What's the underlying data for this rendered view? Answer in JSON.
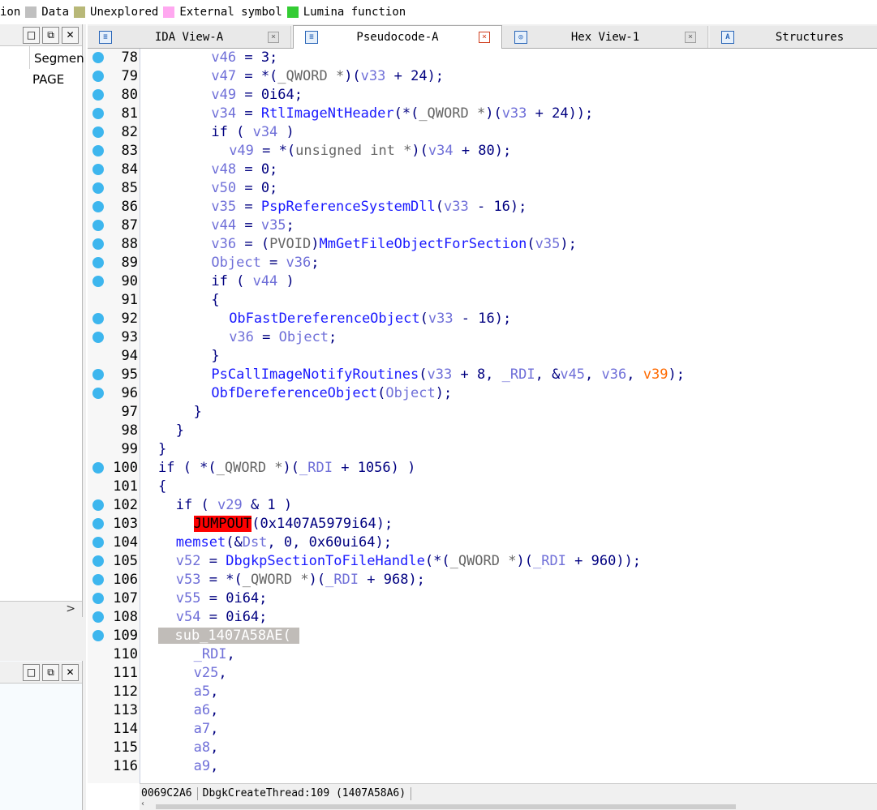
{
  "legend": {
    "items": [
      {
        "label": "ion",
        "color": ""
      },
      {
        "label": "Data",
        "color": "#c0c0c0"
      },
      {
        "label": "Unexplored",
        "color": "#b8b878"
      },
      {
        "label": "External symbol",
        "color": "#ffa8f0"
      },
      {
        "label": "Lumina function",
        "color": "#33cc33"
      }
    ]
  },
  "left_pane": {
    "column_header": "Segmen",
    "rows": [
      "PAGE"
    ],
    "buttons": [
      "□",
      "⧉",
      "✕"
    ]
  },
  "tabs": [
    {
      "label": "IDA View-A",
      "icon": "disassembly-icon",
      "active": false
    },
    {
      "label": "Pseudocode-A",
      "icon": "pseudocode-icon",
      "active": true
    },
    {
      "label": "Hex View-1",
      "icon": "hex-icon",
      "active": false
    },
    {
      "label": "Structures",
      "icon": "structures-icon",
      "active": false
    }
  ],
  "code_lines": [
    {
      "n": "78",
      "dot": true,
      "indent": 6,
      "tokens": [
        [
          "var",
          "v46"
        ],
        [
          "op",
          " = 3;"
        ]
      ]
    },
    {
      "n": "79",
      "dot": true,
      "indent": 6,
      "tokens": [
        [
          "var",
          "v47"
        ],
        [
          "op",
          " = *("
        ],
        [
          "typ",
          "_QWORD *"
        ],
        [
          "op",
          ")("
        ],
        [
          "var",
          "v33"
        ],
        [
          "op",
          " + 24);"
        ]
      ]
    },
    {
      "n": "80",
      "dot": true,
      "indent": 6,
      "tokens": [
        [
          "var",
          "v49"
        ],
        [
          "op",
          " = 0i64;"
        ]
      ]
    },
    {
      "n": "81",
      "dot": true,
      "indent": 6,
      "tokens": [
        [
          "var",
          "v34"
        ],
        [
          "op",
          " = "
        ],
        [
          "fn",
          "RtlImageNtHeader"
        ],
        [
          "op",
          "(*("
        ],
        [
          "typ",
          "_QWORD *"
        ],
        [
          "op",
          ")("
        ],
        [
          "var",
          "v33"
        ],
        [
          "op",
          " + 24));"
        ]
      ]
    },
    {
      "n": "82",
      "dot": true,
      "indent": 6,
      "tokens": [
        [
          "op",
          "if ( "
        ],
        [
          "var",
          "v34"
        ],
        [
          "op",
          " )"
        ]
      ]
    },
    {
      "n": "83",
      "dot": true,
      "indent": 8,
      "tokens": [
        [
          "var",
          "v49"
        ],
        [
          "op",
          " = *("
        ],
        [
          "typ",
          "unsigned int *"
        ],
        [
          "op",
          ")("
        ],
        [
          "var",
          "v34"
        ],
        [
          "op",
          " + 80);"
        ]
      ]
    },
    {
      "n": "84",
      "dot": true,
      "indent": 6,
      "tokens": [
        [
          "var",
          "v48"
        ],
        [
          "op",
          " = 0;"
        ]
      ]
    },
    {
      "n": "85",
      "dot": true,
      "indent": 6,
      "tokens": [
        [
          "var",
          "v50"
        ],
        [
          "op",
          " = 0;"
        ]
      ]
    },
    {
      "n": "86",
      "dot": true,
      "indent": 6,
      "tokens": [
        [
          "var",
          "v35"
        ],
        [
          "op",
          " = "
        ],
        [
          "fn",
          "PspReferenceSystemDll"
        ],
        [
          "op",
          "("
        ],
        [
          "var",
          "v33"
        ],
        [
          "op",
          " - 16);"
        ]
      ]
    },
    {
      "n": "87",
      "dot": true,
      "indent": 6,
      "tokens": [
        [
          "var",
          "v44"
        ],
        [
          "op",
          " = "
        ],
        [
          "var",
          "v35"
        ],
        [
          "op",
          ";"
        ]
      ]
    },
    {
      "n": "88",
      "dot": true,
      "indent": 6,
      "tokens": [
        [
          "var",
          "v36"
        ],
        [
          "op",
          " = ("
        ],
        [
          "typ",
          "PVOID"
        ],
        [
          "op",
          ")"
        ],
        [
          "fn",
          "MmGetFileObjectForSection"
        ],
        [
          "op",
          "("
        ],
        [
          "var",
          "v35"
        ],
        [
          "op",
          ");"
        ]
      ]
    },
    {
      "n": "89",
      "dot": true,
      "indent": 6,
      "tokens": [
        [
          "var",
          "Object"
        ],
        [
          "op",
          " = "
        ],
        [
          "var",
          "v36"
        ],
        [
          "op",
          ";"
        ]
      ]
    },
    {
      "n": "90",
      "dot": true,
      "indent": 6,
      "tokens": [
        [
          "op",
          "if ( "
        ],
        [
          "var",
          "v44"
        ],
        [
          "op",
          " )"
        ]
      ]
    },
    {
      "n": "91",
      "dot": false,
      "indent": 6,
      "tokens": [
        [
          "op",
          "{"
        ]
      ]
    },
    {
      "n": "92",
      "dot": true,
      "indent": 8,
      "tokens": [
        [
          "fn",
          "ObFastDereferenceObject"
        ],
        [
          "op",
          "("
        ],
        [
          "var",
          "v33"
        ],
        [
          "op",
          " - 16);"
        ]
      ]
    },
    {
      "n": "93",
      "dot": true,
      "indent": 8,
      "tokens": [
        [
          "var",
          "v36"
        ],
        [
          "op",
          " = "
        ],
        [
          "var",
          "Object"
        ],
        [
          "op",
          ";"
        ]
      ]
    },
    {
      "n": "94",
      "dot": false,
      "indent": 6,
      "tokens": [
        [
          "op",
          "}"
        ]
      ]
    },
    {
      "n": "95",
      "dot": true,
      "indent": 6,
      "tokens": [
        [
          "fn",
          "PsCallImageNotifyRoutines"
        ],
        [
          "op",
          "("
        ],
        [
          "var",
          "v33"
        ],
        [
          "op",
          " + 8, "
        ],
        [
          "var",
          "_RDI"
        ],
        [
          "op",
          ", &"
        ],
        [
          "var",
          "v45"
        ],
        [
          "op",
          ", "
        ],
        [
          "var",
          "v36"
        ],
        [
          "op",
          ", "
        ],
        [
          "org",
          "v39"
        ],
        [
          "op",
          ");"
        ]
      ]
    },
    {
      "n": "96",
      "dot": true,
      "indent": 6,
      "tokens": [
        [
          "fn",
          "ObfDereferenceObject"
        ],
        [
          "op",
          "("
        ],
        [
          "var",
          "Object"
        ],
        [
          "op",
          ");"
        ]
      ]
    },
    {
      "n": "97",
      "dot": false,
      "indent": 4,
      "tokens": [
        [
          "op",
          "}"
        ]
      ]
    },
    {
      "n": "98",
      "dot": false,
      "indent": 2,
      "tokens": [
        [
          "op",
          "}"
        ]
      ]
    },
    {
      "n": "99",
      "dot": false,
      "indent": 0,
      "tokens": [
        [
          "op",
          "}"
        ]
      ]
    },
    {
      "n": "100",
      "dot": true,
      "indent": 0,
      "tokens": [
        [
          "op",
          "if ( *("
        ],
        [
          "typ",
          "_QWORD *"
        ],
        [
          "op",
          ")("
        ],
        [
          "var",
          "_RDI"
        ],
        [
          "op",
          " + 1056) )"
        ]
      ]
    },
    {
      "n": "101",
      "dot": false,
      "indent": 0,
      "tokens": [
        [
          "op",
          "{"
        ]
      ]
    },
    {
      "n": "102",
      "dot": true,
      "indent": 2,
      "tokens": [
        [
          "op",
          "if ( "
        ],
        [
          "var",
          "v29"
        ],
        [
          "op",
          " & 1 )"
        ]
      ]
    },
    {
      "n": "103",
      "dot": true,
      "indent": 4,
      "tokens": [
        [
          "jump",
          "JUMPOUT"
        ],
        [
          "op",
          "(0x1407A5979i64);"
        ]
      ]
    },
    {
      "n": "104",
      "dot": true,
      "indent": 2,
      "tokens": [
        [
          "fn",
          "memset"
        ],
        [
          "op",
          "(&"
        ],
        [
          "var",
          "Dst"
        ],
        [
          "op",
          ", 0, 0x60ui64);"
        ]
      ]
    },
    {
      "n": "105",
      "dot": true,
      "indent": 2,
      "tokens": [
        [
          "var",
          "v52"
        ],
        [
          "op",
          " = "
        ],
        [
          "fn",
          "DbgkpSectionToFileHandle"
        ],
        [
          "op",
          "(*("
        ],
        [
          "typ",
          "_QWORD *"
        ],
        [
          "op",
          ")("
        ],
        [
          "var",
          "_RDI"
        ],
        [
          "op",
          " + 960));"
        ]
      ]
    },
    {
      "n": "106",
      "dot": true,
      "indent": 2,
      "tokens": [
        [
          "var",
          "v53"
        ],
        [
          "op",
          " = *("
        ],
        [
          "typ",
          "_QWORD *"
        ],
        [
          "op",
          ")("
        ],
        [
          "var",
          "_RDI"
        ],
        [
          "op",
          " + 968);"
        ]
      ]
    },
    {
      "n": "107",
      "dot": true,
      "indent": 2,
      "tokens": [
        [
          "var",
          "v55"
        ],
        [
          "op",
          " = 0i64;"
        ]
      ]
    },
    {
      "n": "108",
      "dot": true,
      "indent": 2,
      "tokens": [
        [
          "var",
          "v54"
        ],
        [
          "op",
          " = 0i64;"
        ]
      ]
    },
    {
      "n": "109",
      "dot": true,
      "indent": 0,
      "tokens": [
        [
          "hl",
          "  sub_1407A58AE( "
        ]
      ]
    },
    {
      "n": "110",
      "dot": false,
      "indent": 4,
      "tokens": [
        [
          "var",
          "_RDI"
        ],
        [
          "op",
          ","
        ]
      ]
    },
    {
      "n": "111",
      "dot": false,
      "indent": 4,
      "tokens": [
        [
          "var",
          "v25"
        ],
        [
          "op",
          ","
        ]
      ]
    },
    {
      "n": "112",
      "dot": false,
      "indent": 4,
      "tokens": [
        [
          "var",
          "a5"
        ],
        [
          "op",
          ","
        ]
      ]
    },
    {
      "n": "113",
      "dot": false,
      "indent": 4,
      "tokens": [
        [
          "var",
          "a6"
        ],
        [
          "op",
          ","
        ]
      ]
    },
    {
      "n": "114",
      "dot": false,
      "indent": 4,
      "tokens": [
        [
          "var",
          "a7"
        ],
        [
          "op",
          ","
        ]
      ]
    },
    {
      "n": "115",
      "dot": false,
      "indent": 4,
      "tokens": [
        [
          "var",
          "a8"
        ],
        [
          "op",
          ","
        ]
      ]
    },
    {
      "n": "116",
      "dot": false,
      "indent": 4,
      "tokens": [
        [
          "var",
          "a9"
        ],
        [
          "op",
          ","
        ]
      ]
    }
  ],
  "status_bar": {
    "offset": "0069C2A6",
    "location": "DbgkCreateThread:109 (1407A58A6)"
  },
  "colors": {
    "breakpoint_dot": "#3db6ee",
    "jumpout_bg": "#ff0000",
    "highlight_bg": "#c0bcb8"
  }
}
